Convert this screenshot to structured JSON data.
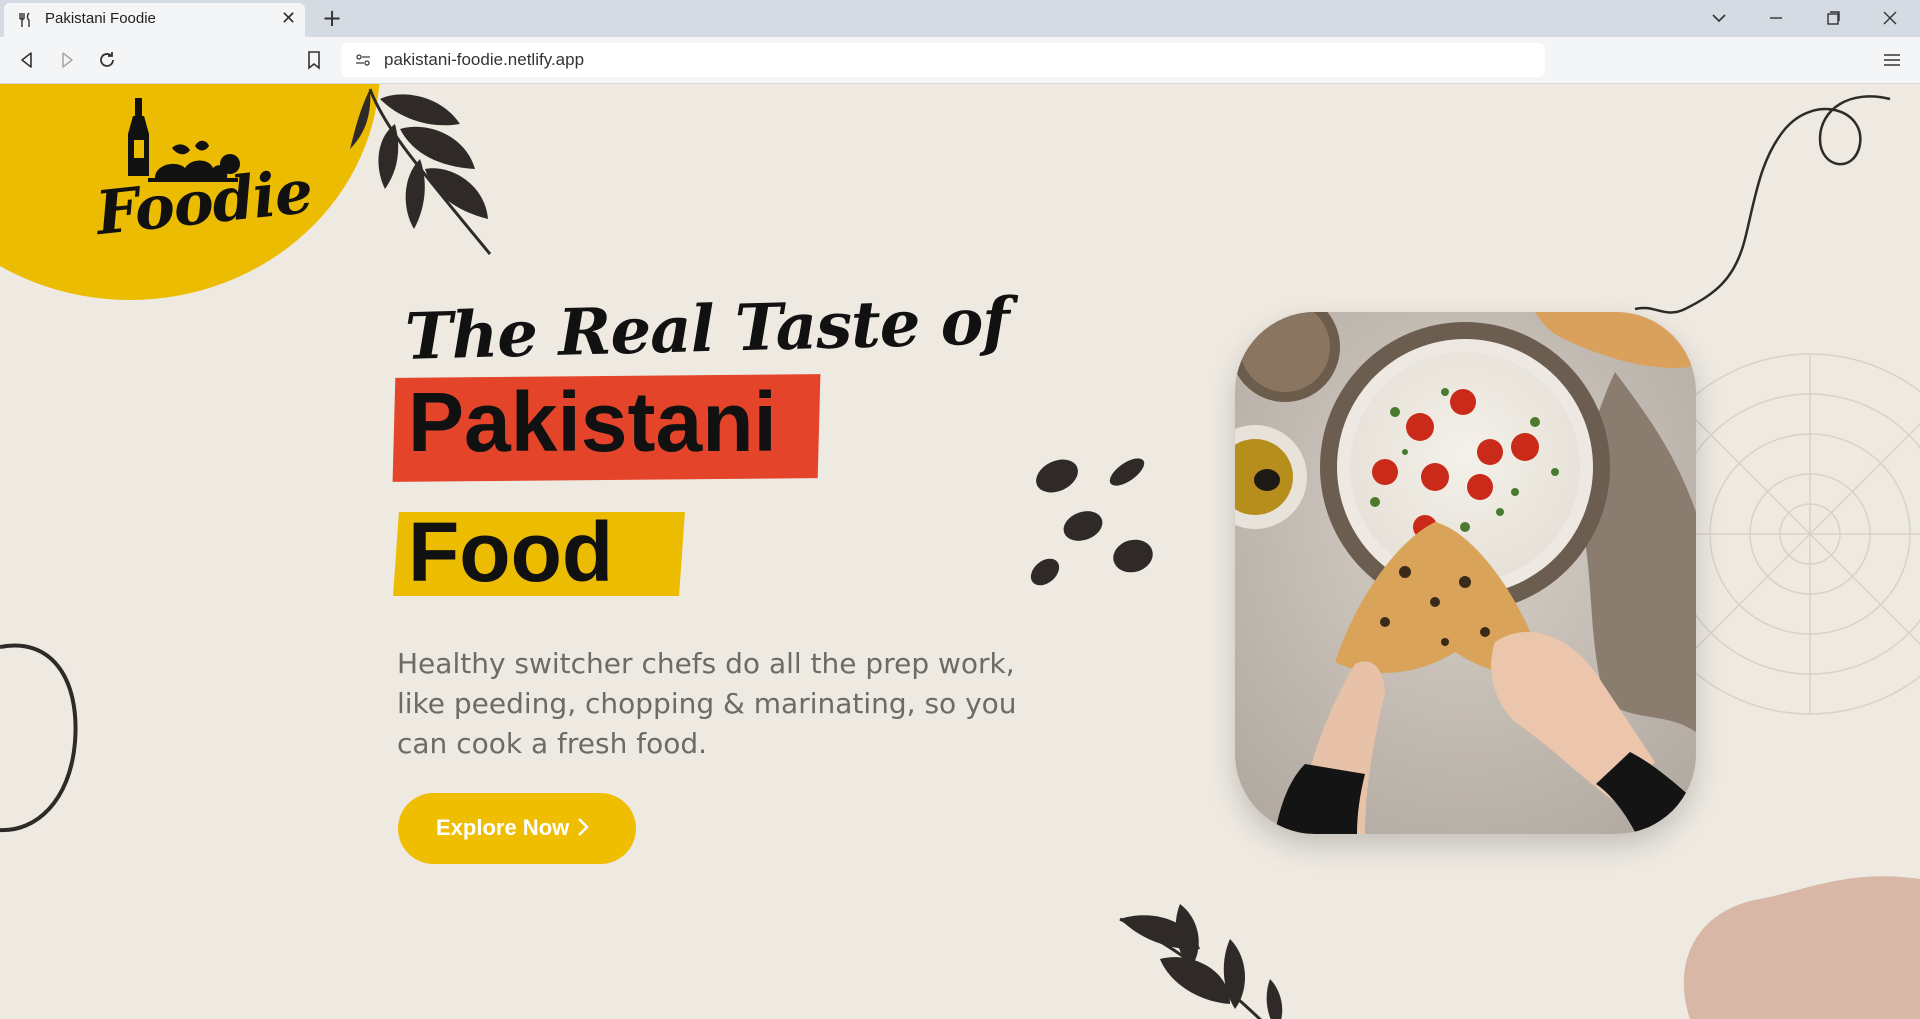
{
  "browser": {
    "tab_title": "Pakistani Foodie",
    "url": "pakistani-foodie.netlify.app",
    "tab_icon": "fork-knife-icon"
  },
  "hero": {
    "logo_text": "Foodie",
    "headline_line1": "The Real Taste of",
    "headline_line2": "Pakistani",
    "headline_line3": "Food",
    "description": "Healthy switcher chefs do all the prep work, like peeding, chopping & marinating, so you can cook a fresh food.",
    "cta_label": "Explore Now"
  },
  "colors": {
    "brand_yellow": "#ecbc02",
    "accent_red": "#e4442a",
    "background": "#eeeae2",
    "text_dark": "#111111",
    "text_muted": "#6d6b68"
  }
}
